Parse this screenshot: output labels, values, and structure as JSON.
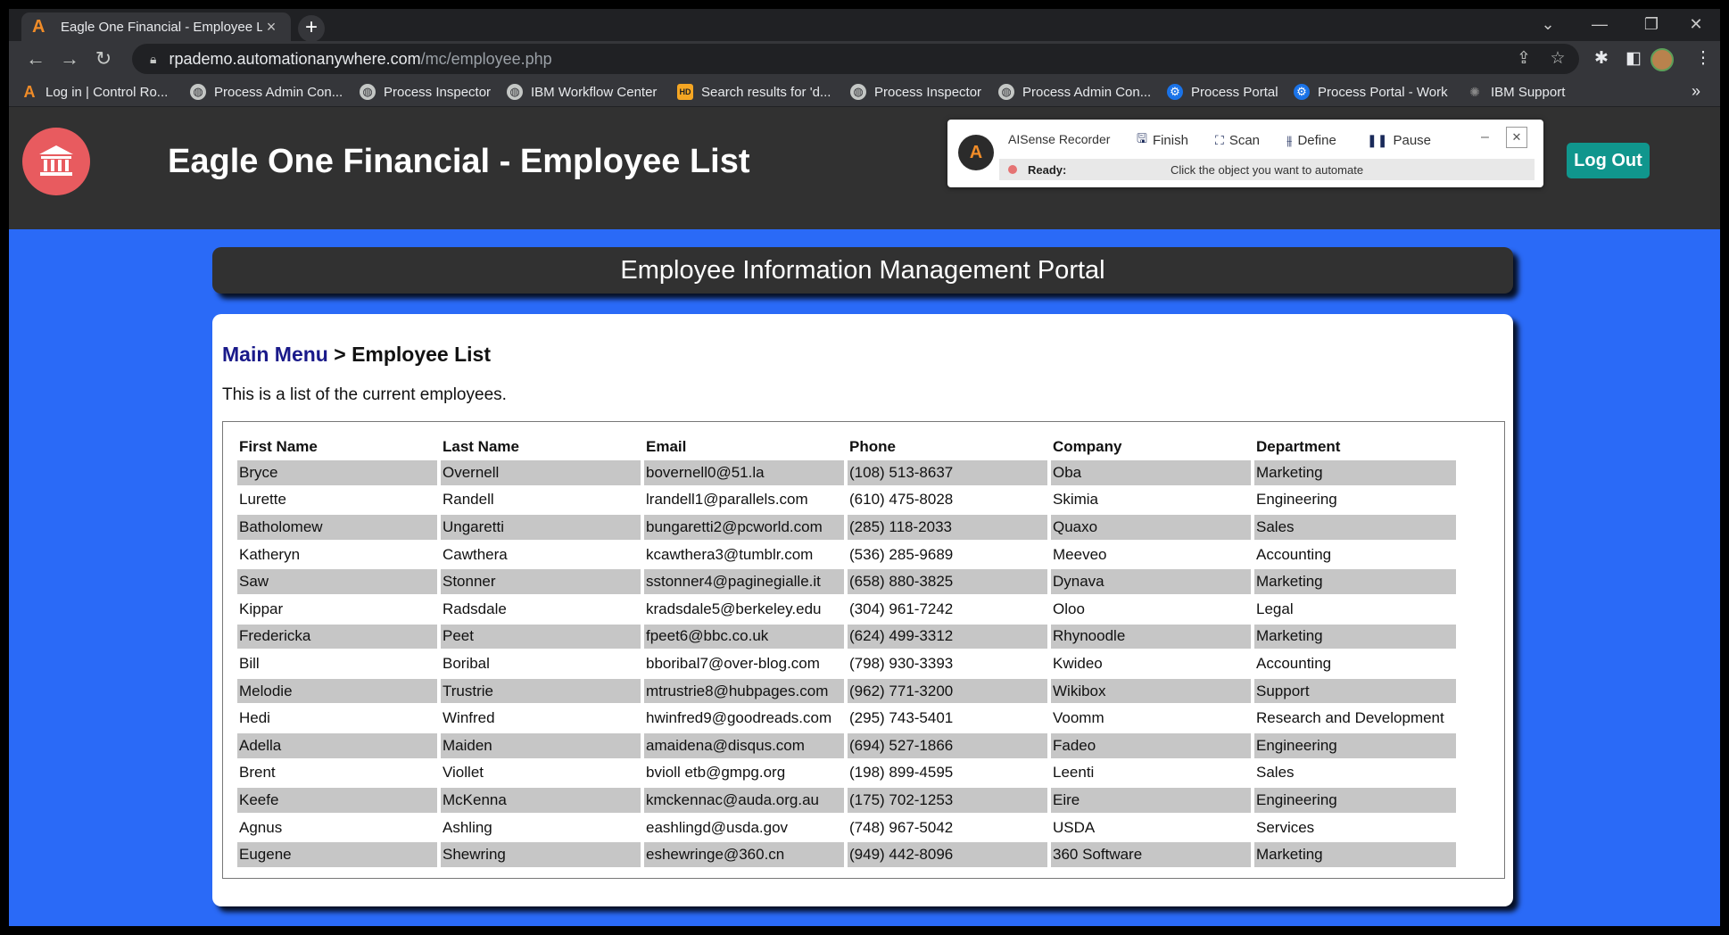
{
  "browser": {
    "tab_title": "Eagle One Financial - Employee L",
    "tab_close": "×",
    "new_tab": "+",
    "url_host": "rpademo.automationanywhere.com",
    "url_path": "/mc/employee.php",
    "bookmarks": [
      {
        "label": "Log in | Control Ro...",
        "icon": "automation-anywhere-icon"
      },
      {
        "label": "Process Admin Con...",
        "icon": "globe-icon"
      },
      {
        "label": "Process Inspector",
        "icon": "globe-icon"
      },
      {
        "label": "IBM Workflow Center",
        "icon": "globe-icon"
      },
      {
        "label": "Search results for 'd...",
        "icon": "hd-icon"
      },
      {
        "label": "Process Inspector",
        "icon": "globe-icon"
      },
      {
        "label": "Process Admin Con...",
        "icon": "globe-icon"
      },
      {
        "label": "Process Portal",
        "icon": "gear-icon"
      },
      {
        "label": "Process Portal - Work",
        "icon": "gear-icon"
      },
      {
        "label": "IBM Support",
        "icon": "ibm-icon"
      }
    ],
    "bookmarks_more": "»"
  },
  "header": {
    "title": "Eagle One Financial - Employee List",
    "logout_label": "Log Out",
    "brand_color": "#e85b5f",
    "accent_color": "#10968d"
  },
  "portal": {
    "banner": "Employee Information Management Portal"
  },
  "content": {
    "breadcrumb_link": "Main Menu",
    "breadcrumb_sep": " > ",
    "breadcrumb_current": "Employee List",
    "intro": "This is a list of the current employees."
  },
  "table": {
    "columns": [
      "First Name",
      "Last Name",
      "Email",
      "Phone",
      "Company",
      "Department"
    ],
    "rows": [
      [
        "Bryce",
        "Overnell",
        "bovernell0@51.la",
        "(108) 513-8637",
        "Oba",
        "Marketing"
      ],
      [
        "Lurette",
        "Randell",
        "lrandell1@parallels.com",
        "(610) 475-8028",
        "Skimia",
        "Engineering"
      ],
      [
        "Batholomew",
        "Ungaretti",
        "bungaretti2@pcworld.com",
        "(285) 118-2033",
        "Quaxo",
        "Sales"
      ],
      [
        "Katheryn",
        "Cawthera",
        "kcawthera3@tumblr.com",
        "(536) 285-9689",
        "Meeveo",
        "Accounting"
      ],
      [
        "Saw",
        "Stonner",
        "sstonner4@paginegialle.it",
        "(658) 880-3825",
        "Dynava",
        "Marketing"
      ],
      [
        "Kippar",
        "Radsdale",
        "kradsdale5@berkeley.edu",
        "(304) 961-7242",
        "Oloo",
        "Legal"
      ],
      [
        "Fredericka",
        "Peet",
        "fpeet6@bbc.co.uk",
        "(624) 499-3312",
        "Rhynoodle",
        "Marketing"
      ],
      [
        "Bill",
        "Boribal",
        "bboribal7@over-blog.com",
        "(798) 930-3393",
        "Kwideo",
        "Accounting"
      ],
      [
        "Melodie",
        "Trustrie",
        "mtrustrie8@hubpages.com",
        "(962) 771-3200",
        "Wikibox",
        "Support"
      ],
      [
        "Hedi",
        "Winfred",
        "hwinfred9@goodreads.com",
        "(295) 743-5401",
        "Voomm",
        "Research and Development"
      ],
      [
        "Adella",
        "Maiden",
        "amaidena@disqus.com",
        "(694) 527-1866",
        "Fadeo",
        "Engineering"
      ],
      [
        "Brent",
        "Viollet",
        "bvioll etb@gmpg.org",
        "(198) 899-4595",
        "Leenti",
        "Sales"
      ],
      [
        "Keefe",
        "McKenna",
        "kmckennac@auda.org.au",
        "(175) 702-1253",
        "Eire",
        "Engineering"
      ],
      [
        "Agnus",
        "Ashling",
        "eashlingd@usda.gov",
        "(748) 967-5042",
        "USDA",
        "Services"
      ],
      [
        "Eugene",
        "Shewring",
        "eshewringe@360.cn",
        "(949) 442-8096",
        "360 Software",
        "Marketing"
      ]
    ]
  },
  "recorder": {
    "name": "AISense Recorder",
    "finish": "Finish",
    "scan": "Scan",
    "define": "Define",
    "pause": "Pause",
    "status": "Ready:",
    "message": "Click the object you want to automate",
    "minimize": "–",
    "close": "✕"
  }
}
